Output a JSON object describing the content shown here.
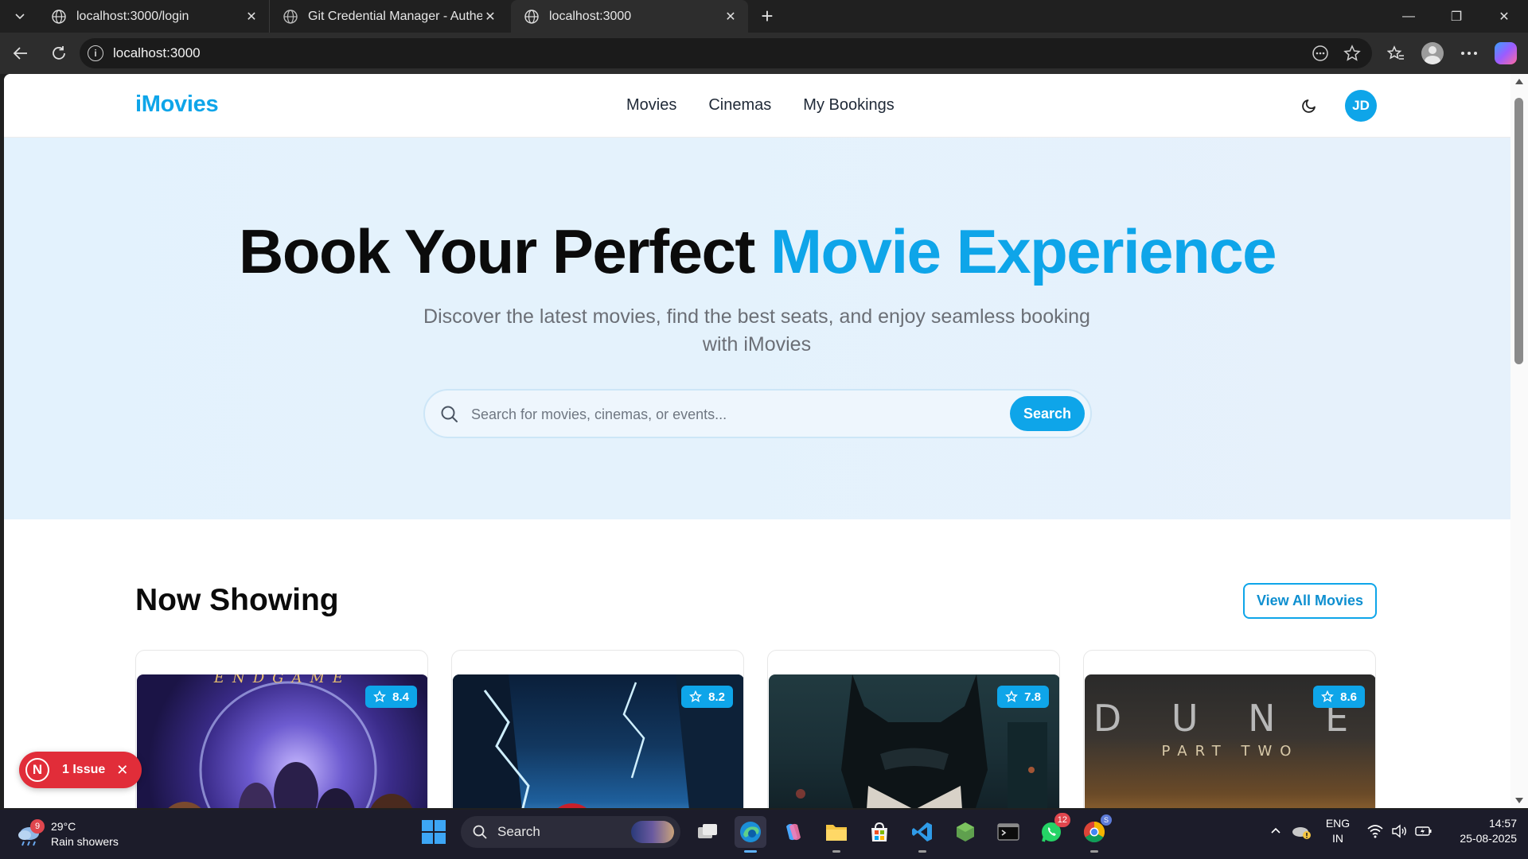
{
  "browser": {
    "tabs": [
      {
        "title": "localhost:3000/login"
      },
      {
        "title": "Git Credential Manager - Authent"
      },
      {
        "title": "localhost:3000"
      }
    ],
    "url": "localhost:3000"
  },
  "site": {
    "brand": "iMovies",
    "nav": [
      "Movies",
      "Cinemas",
      "My Bookings"
    ],
    "avatar_initials": "JD",
    "accent_color": "#0ea5e9"
  },
  "hero": {
    "title_plain": "Book Your Perfect ",
    "title_accent": "Movie Experience",
    "subtitle": "Discover the latest movies, find the best seats, and enjoy seamless booking with iMovies",
    "search_placeholder": "Search for movies, cinemas, or events...",
    "search_button": "Search"
  },
  "now_showing": {
    "title": "Now Showing",
    "view_all": "View All Movies",
    "movies": [
      {
        "rating": "8.4",
        "poster_text": "ENDGAME"
      },
      {
        "rating": "8.2",
        "poster_text": ""
      },
      {
        "rating": "7.8",
        "poster_text": ""
      },
      {
        "rating": "8.6",
        "poster_text": "PART TWO",
        "poster_title": "D U N E"
      }
    ]
  },
  "dev_overlay": {
    "logo": "N",
    "label": "1 Issue"
  },
  "taskbar": {
    "weather_temp": "29°C",
    "weather_desc": "Rain showers",
    "weather_badge": "9",
    "search_label": "Search",
    "whatsapp_badge": "12",
    "chrome_badge": "S",
    "lang_line1": "ENG",
    "lang_line2": "IN",
    "time": "14:57",
    "date": "25-08-2025"
  }
}
